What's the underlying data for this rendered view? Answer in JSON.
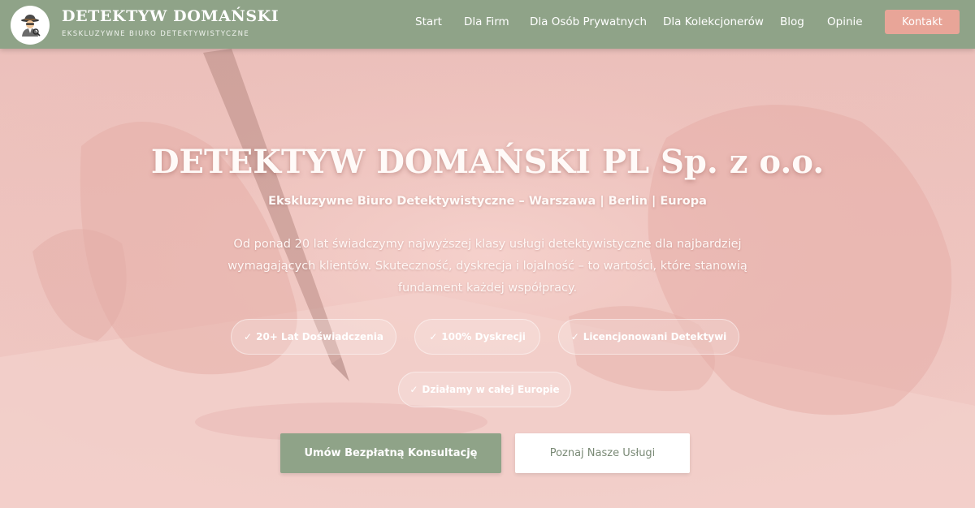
{
  "header": {
    "brand_title": "DETEKTYW DOMAŃSKI",
    "brand_subtitle": "EKSKLUZYWNE BIURO DETEKTYWISTYCZNE",
    "logo_icon": "detective-icon",
    "nav": [
      {
        "label": "Start"
      },
      {
        "label": "Dla Firm"
      },
      {
        "label": "Dla Osób Prywatnych"
      },
      {
        "label": "Dla Kolekcjonerów"
      },
      {
        "label": "Blog"
      },
      {
        "label": "Opinie"
      }
    ],
    "contact_label": "Kontakt"
  },
  "hero": {
    "title": "DETEKTYW DOMAŃSKI PL Sp. z o.o.",
    "subtitle": "Ekskluzywne Biuro Detektywistyczne – Warszawa | Berlin | Europa",
    "description": "Od ponad 20 lat świadczymy najwyższej klasy usługi detektywistyczne dla najbardziej wymagających klientów. Skuteczność, dyskrecja i lojalność – to wartości, które stanowią fundament każdej współpracy.",
    "badges": [
      {
        "mark": "✓",
        "label": "20+ Lat Doświadczenia"
      },
      {
        "mark": "✓",
        "label": "100% Dyskrecji"
      },
      {
        "mark": "✓",
        "label": "Licencjonowani Detektywi"
      },
      {
        "mark": "✓",
        "label": "Działamy w całej Europie"
      }
    ],
    "cta_primary": "Umów Bezpłatną Konsultację",
    "cta_secondary": "Poznaj Nasze Usługi"
  },
  "colors": {
    "header_bg": "#8fa388",
    "accent_contact": "#e8a598",
    "hero_overlay": "#efc4c0",
    "primary_button": "#8fa388",
    "secondary_button": "#ffffff"
  }
}
